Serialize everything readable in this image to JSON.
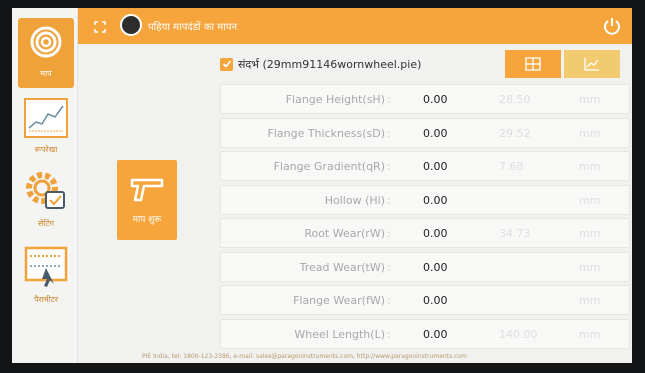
{
  "app": {
    "title": "पहिया मापदंडों का मापन",
    "colors": {
      "accent": "#f5a53b",
      "accent_light": "#f2cb6e",
      "background": "#f1f1f0"
    }
  },
  "sidebar": {
    "items": [
      {
        "label": "माप",
        "icon": "wheel-icon",
        "active": true
      },
      {
        "label": "रूपरेखा",
        "icon": "profile-chart-icon",
        "active": false
      },
      {
        "label": "सेटिंग",
        "icon": "settings-gear-icon",
        "active": false
      },
      {
        "label": "पैरामीटर",
        "icon": "parameter-icon",
        "active": false
      }
    ]
  },
  "main": {
    "start_button_label": "माप शुरू",
    "reference": {
      "label": "संदर्भ (29mm91146wornwheel.pie)",
      "checked": true
    },
    "rows": [
      {
        "name": "Flange Height(sH)",
        "value": "0.00",
        "ref": "28.50",
        "unit": "mm"
      },
      {
        "name": "Flange Thickness(sD)",
        "value": "0.00",
        "ref": "29.52",
        "unit": "mm"
      },
      {
        "name": "Flange Gradient(qR)",
        "value": "0.00",
        "ref": "7.68",
        "unit": "mm"
      },
      {
        "name": "Hollow (Hi)",
        "value": "0.00",
        "ref": "",
        "unit": "mm"
      },
      {
        "name": "Root Wear(rW)",
        "value": "0.00",
        "ref": "34.73",
        "unit": "mm"
      },
      {
        "name": "Tread Wear(tW)",
        "value": "0.00",
        "ref": "",
        "unit": "mm"
      },
      {
        "name": "Flange Wear(fW)",
        "value": "0.00",
        "ref": "",
        "unit": "mm"
      },
      {
        "name": "Wheel Length(L)",
        "value": "0.00",
        "ref": "140.00",
        "unit": "mm"
      }
    ]
  },
  "footer": {
    "text": "PIE India, tel: 1800-123-2386, e-mail: sales@paragoninstruments.com, http://www.paragoninstruments.com"
  }
}
